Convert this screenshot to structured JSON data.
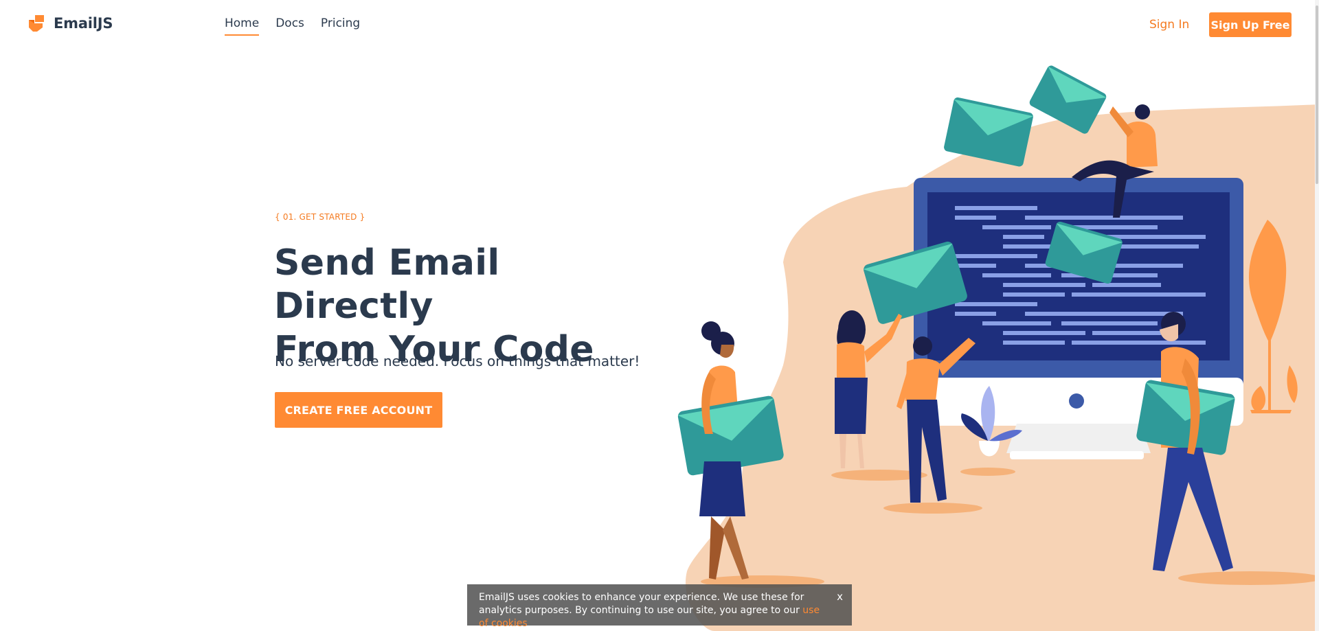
{
  "header": {
    "logo_text": "EmailJS",
    "logo_icon": "emailjs-logo-icon",
    "nav": [
      {
        "label": "Home",
        "active": true
      },
      {
        "label": "Docs",
        "active": false
      },
      {
        "label": "Pricing",
        "active": false
      }
    ],
    "sign_in": "Sign In",
    "sign_up": "Sign Up Free"
  },
  "hero": {
    "eyebrow": "{ 01. GET STARTED }",
    "title_line1": "Send Email Directly",
    "title_line2": "From Your Code",
    "subtitle": "No server code needed. Focus on things that matter!",
    "cta": "CREATE FREE ACCOUNT"
  },
  "cookie_banner": {
    "text": "EmailJS uses cookies to enhance your experience. We use these for analytics purposes. By continuing to use our site, you agree to our ",
    "link": "use of cookies",
    "close": "x"
  },
  "colors": {
    "accent": "#ff8a33",
    "text": "#2b3a4d",
    "blob": "#f7d3b5",
    "monitor": "#3c5aa8",
    "screen": "#1e2f7d",
    "envelope": "#5fd6bd",
    "envelope_dark": "#2f9a99"
  }
}
